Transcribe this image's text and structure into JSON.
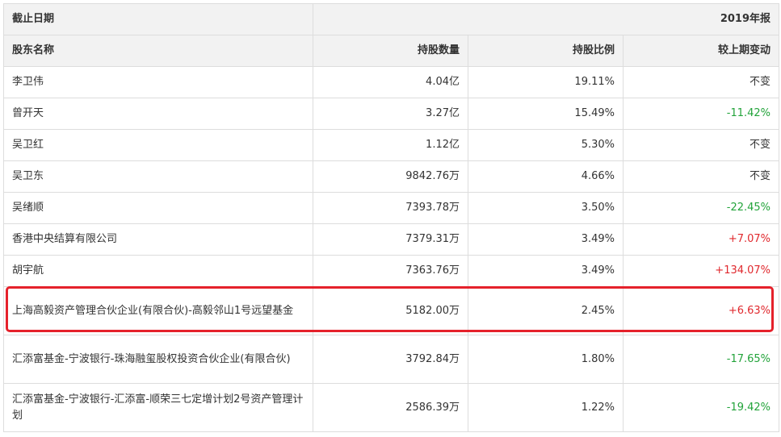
{
  "table": {
    "header1": {
      "date_label": "截止日期",
      "period": "2019年报"
    },
    "header2": {
      "name": "股东名称",
      "shares": "持股数量",
      "ratio": "持股比例",
      "change": "较上期变动"
    },
    "rows": [
      {
        "name": "李卫伟",
        "shares": "4.04亿",
        "ratio": "19.11%",
        "change": "不变",
        "trend": "flat"
      },
      {
        "name": "曾开天",
        "shares": "3.27亿",
        "ratio": "15.49%",
        "change": "-11.42%",
        "trend": "down"
      },
      {
        "name": "吴卫红",
        "shares": "1.12亿",
        "ratio": "5.30%",
        "change": "不变",
        "trend": "flat"
      },
      {
        "name": "吴卫东",
        "shares": "9842.76万",
        "ratio": "4.66%",
        "change": "不变",
        "trend": "flat"
      },
      {
        "name": "吴绪顺",
        "shares": "7393.78万",
        "ratio": "3.50%",
        "change": "-22.45%",
        "trend": "down"
      },
      {
        "name": "香港中央结算有限公司",
        "shares": "7379.31万",
        "ratio": "3.49%",
        "change": "+7.07%",
        "trend": "up"
      },
      {
        "name": "胡宇航",
        "shares": "7363.76万",
        "ratio": "3.49%",
        "change": "+134.07%",
        "trend": "up"
      },
      {
        "name": "上海高毅资产管理合伙企业(有限合伙)-高毅邻山1号远望基金",
        "shares": "5182.00万",
        "ratio": "2.45%",
        "change": "+6.63%",
        "trend": "up",
        "highlighted": true
      },
      {
        "name": "汇添富基金-宁波银行-珠海融玺股权投资合伙企业(有限合伙)",
        "shares": "3792.84万",
        "ratio": "1.80%",
        "change": "-17.65%",
        "trend": "down"
      },
      {
        "name": "汇添富基金-宁波银行-汇添富-顺荣三七定增计划2号资产管理计划",
        "shares": "2586.39万",
        "ratio": "1.22%",
        "change": "-19.42%",
        "trend": "down"
      }
    ]
  },
  "colors": {
    "up": "#e0282d",
    "down": "#22a33a",
    "highlight_border": "#e5212b",
    "header_bg": "#f2f2f2",
    "border": "#dddddd"
  }
}
